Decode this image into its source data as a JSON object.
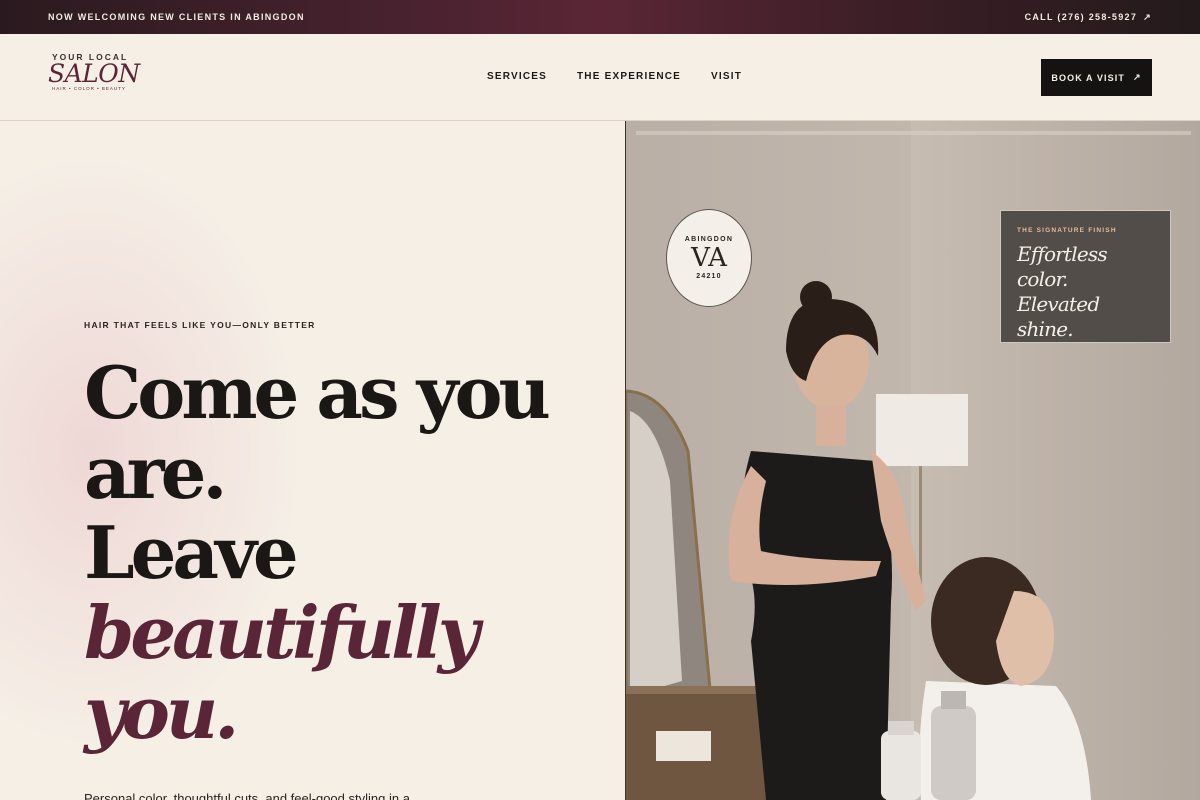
{
  "topbar": {
    "message": "NOW WELCOMING NEW CLIENTS IN ABINGDON",
    "call_label": "CALL (276) 258-5927",
    "call_arrow": "↗"
  },
  "header": {
    "logo": {
      "small": "YOUR LOCAL",
      "big": "SALON",
      "tagline": "HAIR • COLOR • BEAUTY"
    },
    "nav": [
      "SERVICES",
      "THE EXPERIENCE",
      "VISIT"
    ],
    "cta": {
      "label": "BOOK A VISIT",
      "arrow": "↗"
    }
  },
  "hero": {
    "eyebrow": "HAIR THAT FEELS LIKE YOU—ONLY BETTER",
    "headline_lines": [
      "Come as you",
      "are.",
      "Leave"
    ],
    "headline_accent": [
      "beautifully",
      "you."
    ],
    "subcopy": "Personal color, thoughtful cuts, and feel-good styling in a"
  },
  "badge": {
    "city": "ABINGDON",
    "state": "VA",
    "zip": "24210"
  },
  "signature_card": {
    "kicker": "THE SIGNATURE FINISH",
    "lines": [
      "Effortless",
      "color.",
      "Elevated shine."
    ]
  },
  "colors": {
    "accent": "#5b2538",
    "dark": "#141312",
    "background": "#f5efe6"
  }
}
